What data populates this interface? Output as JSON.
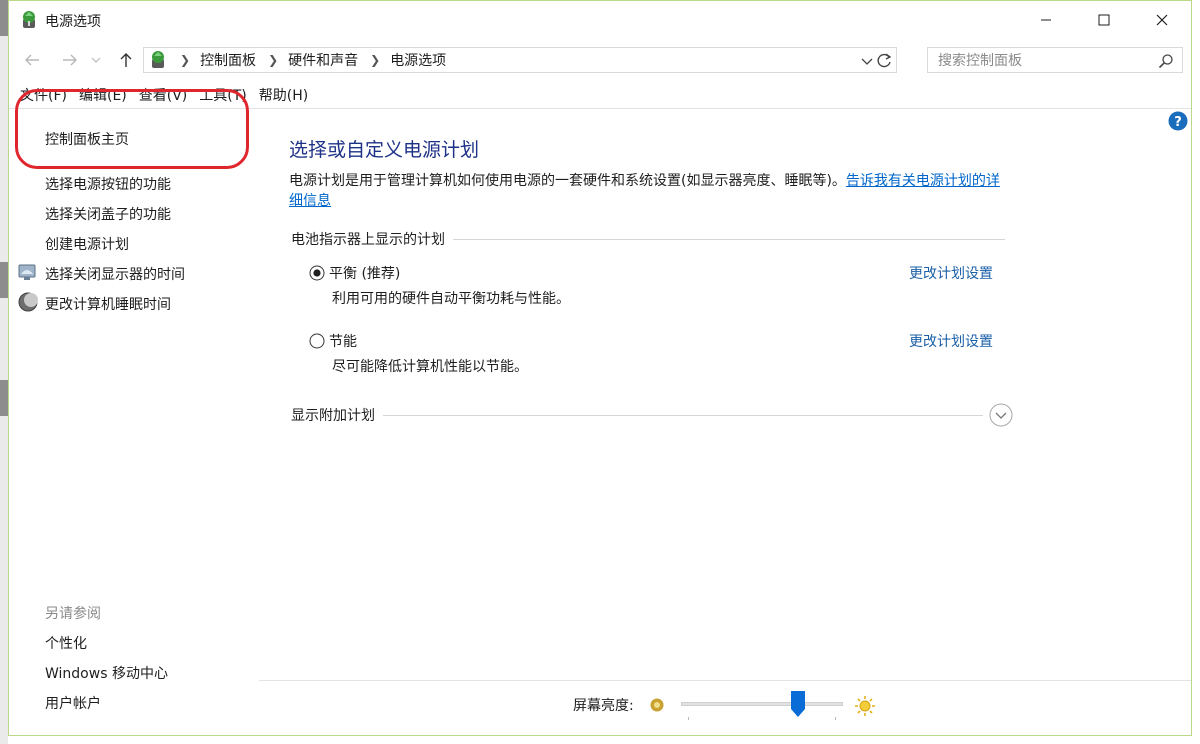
{
  "window": {
    "title": "电源选项",
    "controls": [
      "minimize",
      "maximize",
      "close"
    ]
  },
  "navigation": {
    "breadcrumbs": [
      "控制面板",
      "硬件和声音",
      "电源选项"
    ],
    "search_placeholder": "搜索控制面板"
  },
  "menu": {
    "items": [
      "文件(F)",
      "编辑(E)",
      "查看(V)",
      "工具(T)",
      "帮助(H)"
    ]
  },
  "sidebar": {
    "home_link": "控制面板主页",
    "links": [
      "选择电源按钮的功能",
      "选择关闭盖子的功能",
      "创建电源计划",
      "选择关闭显示器的时间",
      "更改计算机睡眠时间"
    ],
    "see_also_heading": "另请参阅",
    "see_also": [
      "个性化",
      "Windows 移动中心",
      "用户帐户"
    ]
  },
  "main": {
    "title": "选择或自定义电源计划",
    "description": "电源计划是用于管理计算机如何使用电源的一套硬件和系统设置(如显示器亮度、睡眠等)。",
    "description_link": "告诉我有关电源计划的详细信息",
    "group_heading": "电池指示器上显示的计划",
    "plans": [
      {
        "name": "平衡 (推荐)",
        "description": "利用可用的硬件自动平衡功耗与性能。",
        "link": "更改计划设置",
        "selected": true
      },
      {
        "name": "节能",
        "description": "尽可能降低计算机性能以节能。",
        "link": "更改计划设置",
        "selected": false
      }
    ],
    "show_more": "显示附加计划"
  },
  "brightness": {
    "label": "屏幕亮度:",
    "value_fraction": 0.72
  },
  "colors": {
    "title_blue": "#1e3287",
    "link_blue": "#1a5fa8",
    "highlight_red": "#e0262d",
    "slider_blue": "#0a6cd6"
  }
}
